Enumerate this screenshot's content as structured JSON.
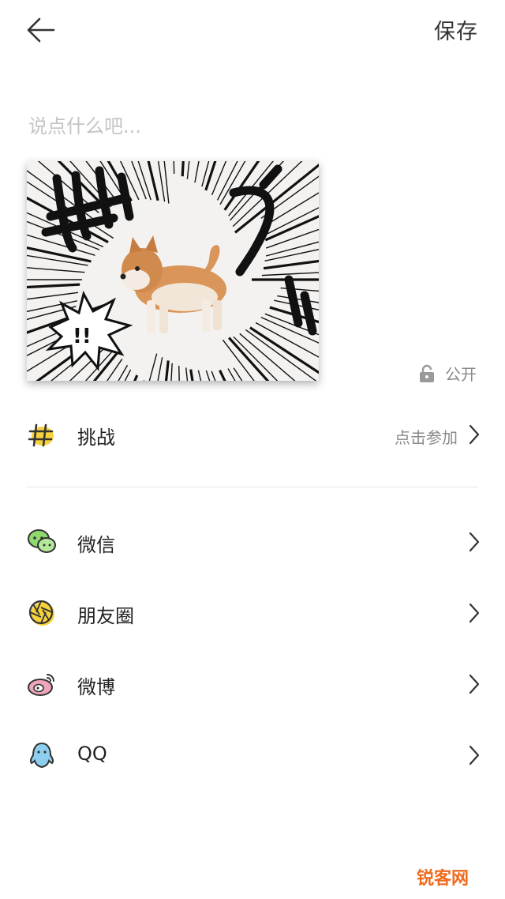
{
  "header": {
    "save_label": "保存"
  },
  "caption": {
    "placeholder": "说点什么吧..."
  },
  "visibility": {
    "label": "公开"
  },
  "challenge": {
    "label": "挑战",
    "hint": "点击参加"
  },
  "share": [
    {
      "label": "微信",
      "icon": "wechat-icon"
    },
    {
      "label": "朋友圈",
      "icon": "moments-icon"
    },
    {
      "label": "微博",
      "icon": "weibo-icon"
    },
    {
      "label": "QQ",
      "icon": "qq-icon"
    }
  ],
  "watermark": "锐客网",
  "colors": {
    "accent_yellow": "#f5d23c",
    "wechat_green": "#8fd96e",
    "weibo_pink": "#f0a5b8",
    "qq_blue": "#8ecfef",
    "watermark": "#f06b1e"
  }
}
